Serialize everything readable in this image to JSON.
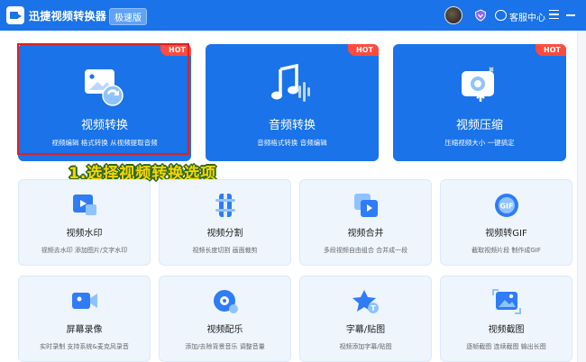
{
  "app": {
    "title": "迅捷视频转换器",
    "edition": "极速版"
  },
  "header": {
    "support_label": "客服中心"
  },
  "feature_cards": [
    {
      "title": "视频转换",
      "desc": "视频编辑 格式转换 从视频提取音频",
      "badge": "HOT"
    },
    {
      "title": "音频转换",
      "desc": "音频格式转换 音频编辑",
      "badge": "HOT"
    },
    {
      "title": "视频压缩",
      "desc": "压缩视频大小 一键搞定",
      "badge": "HOT"
    }
  ],
  "annotation": "1.选择视频转换选项",
  "tools": [
    {
      "title": "视频水印",
      "desc": "视频去水印 添加图片/文字水印",
      "icon": "video-watermark-icon"
    },
    {
      "title": "视频分割",
      "desc": "视频长度切割 画面裁剪",
      "icon": "video-split-icon"
    },
    {
      "title": "视频合并",
      "desc": "多段视频自由组合 合并成一段",
      "icon": "video-merge-icon"
    },
    {
      "title": "视频转GIF",
      "desc": "截取视频片段 制作成GIF",
      "icon": "gif-icon"
    },
    {
      "title": "屏幕录像",
      "desc": "实时录制 支持系统&麦克风录音",
      "icon": "screen-record-icon"
    },
    {
      "title": "视频配乐",
      "desc": "添加/去除背景音乐 调整音量",
      "icon": "music-icon"
    },
    {
      "title": "字幕/贴图",
      "desc": "视频添加字幕/贴图",
      "icon": "subtitle-icon"
    },
    {
      "title": "视频截图",
      "desc": "逐帧截图 连续截图 输出长图",
      "icon": "screenshot-icon"
    }
  ],
  "colors": {
    "primary": "#1a73e8",
    "hot": "#ff4b3e",
    "card_bg": "#eef5fd",
    "highlight": "#e02020",
    "annotation": "#f5d400"
  }
}
